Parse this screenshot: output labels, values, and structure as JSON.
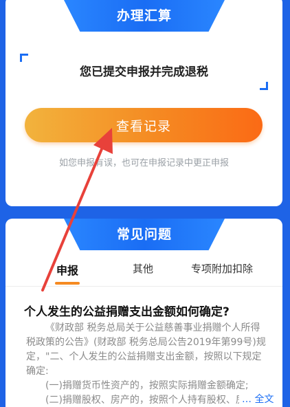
{
  "summary_card": {
    "header": "办理汇算",
    "status": "您已提交申报并完成退税",
    "view_records_button": "查看记录",
    "hint": "如您申报有误，也可在申报记录中更正申报"
  },
  "faq_card": {
    "header": "常见问题",
    "tabs": [
      "申报",
      "其他",
      "专项附加扣除"
    ],
    "active_tab": "申报",
    "question": "个人发生的公益捐赠支出金额如何确定?",
    "answer_lines": [
      "《财政部 税务总局关于公益慈善事业捐赠个人所得税政策的公告》(财政部 税务总局公告2019年第99号)规定，\"二、个人发生的公益捐赠支出金额，按照以下规定确定:",
      "(一)捐赠货币性资产的，按照实际捐赠金额确定;",
      "(二)捐赠股权、房产的，按照个人持有股权、房产"
    ],
    "full_text_link": "全文"
  },
  "colors": {
    "background": "#1e63e6",
    "accent_blue": "#1a6df4",
    "button_orange": "#f58a22",
    "annotation_arrow": "#e8413a"
  }
}
